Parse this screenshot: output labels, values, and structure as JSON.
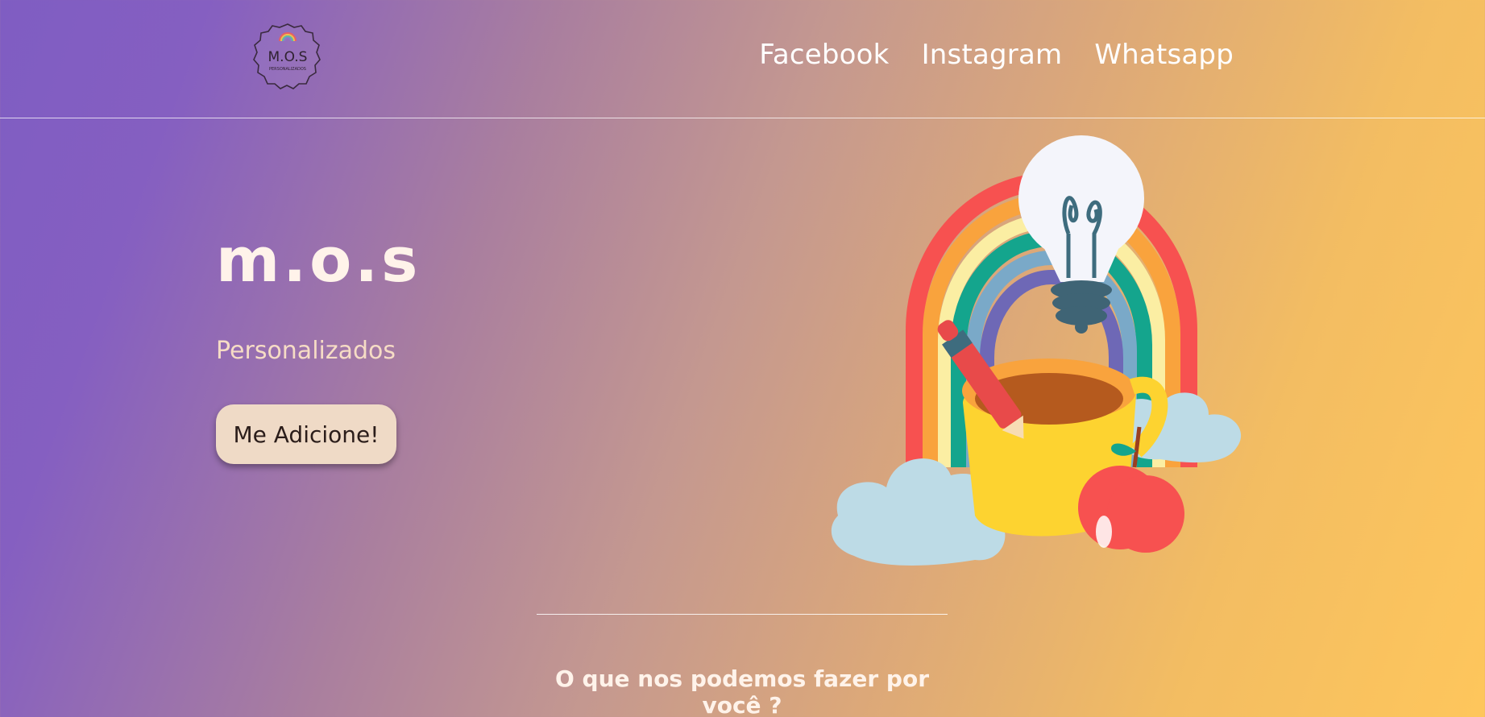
{
  "header": {
    "logo": {
      "text": "M.O.S",
      "subtext": "PERSONALIZADOS",
      "icon": "rainbow-badge-logo"
    },
    "nav": [
      {
        "label": "Facebook"
      },
      {
        "label": "Instagram"
      },
      {
        "label": "Whatsapp"
      }
    ]
  },
  "hero": {
    "title": "m.o.s",
    "subtitle": "Personalizados",
    "button_label": "Me Adicione!",
    "illustration": "rainbow-lightbulb-mug-apple-clouds"
  },
  "section": {
    "title": "O que nos podemos fazer por você ?"
  },
  "colors": {
    "gradient_start": "#7f5dc2",
    "gradient_end": "#fec65c",
    "button_bg": "#efdac6",
    "title_text": "#fff3ea"
  }
}
